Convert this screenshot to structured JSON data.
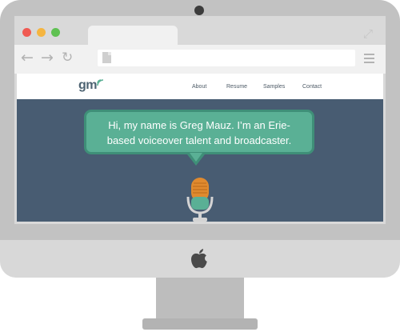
{
  "browser": {
    "window_controls": [
      "close",
      "minimize",
      "maximize"
    ],
    "colors": {
      "close": "#f05a52",
      "minimize": "#f5b540",
      "maximize": "#5fc152"
    },
    "back_icon": "arrow-left-icon",
    "forward_icon": "arrow-right-icon",
    "reload_icon": "reload-icon",
    "menu_icon": "hamburger-menu-icon",
    "url": ""
  },
  "site": {
    "logo": "gm",
    "nav": [
      "About",
      "Resume",
      "Samples",
      "Contact"
    ],
    "hero": {
      "line1": "Hi, my name is Greg Mauz. I’m an Erie-",
      "line2": "based voiceover talent and broadcaster."
    },
    "colors": {
      "hero_bg": "#485c72",
      "bubble": "#5ab095",
      "accent": "#5ab095"
    }
  },
  "device": {
    "logo_icon": "apple-logo-icon"
  }
}
